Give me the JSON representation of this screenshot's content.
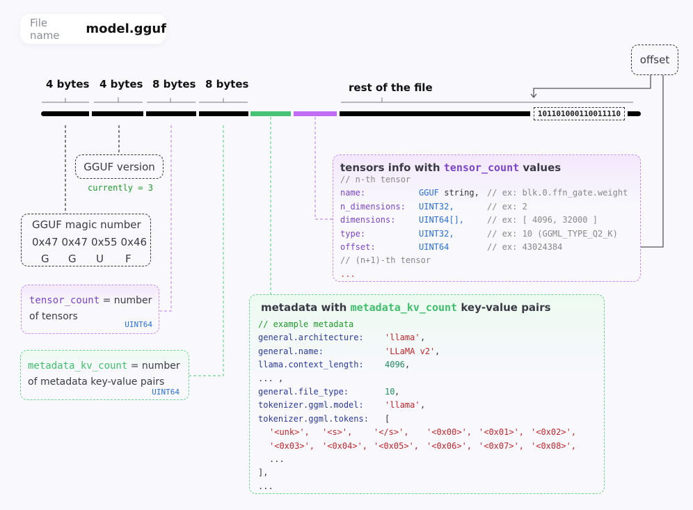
{
  "file": {
    "label": "File name",
    "value": "model.gguf"
  },
  "header_fields": [
    {
      "size": "4 bytes",
      "color": "#000000"
    },
    {
      "size": "4 bytes",
      "color": "#000000"
    },
    {
      "size": "8 bytes",
      "color": "#000000"
    },
    {
      "size": "8 bytes",
      "color": "#000000"
    }
  ],
  "sections": {
    "metadata_color": "#45c275",
    "tensors_info_color": "#c06cf5"
  },
  "rest": {
    "label": "rest of the file",
    "binary": "101101000110011110",
    "offset_label": "offset"
  },
  "version": {
    "title": "GGUF version",
    "note": "currently = 3"
  },
  "magic": {
    "title": "GGUF magic number",
    "hex": [
      "0x47",
      "0x47",
      "0x55",
      "0x46"
    ],
    "chars": [
      "G",
      "G",
      "U",
      "F"
    ]
  },
  "tensor_count": {
    "name": "tensor_count",
    "desc1": "= number",
    "desc2": "of tensors",
    "type": "UINT64"
  },
  "metadata_kv_count": {
    "name": "metadata_kv_count",
    "desc1": "= number",
    "desc2": "of metadata key-value pairs",
    "type": "UINT64"
  },
  "tensors_info": {
    "title_pre": "tensors info with",
    "title_code": "tensor_count",
    "title_post": "values",
    "lines": [
      [
        {
          "t": "// n-th tensor",
          "c": "com",
          "col": 0
        }
      ],
      [
        {
          "t": "name:",
          "c": "key",
          "col": 0
        },
        {
          "t": "GGUF",
          "c": "type",
          "col": 1
        },
        {
          "t": " string,",
          "c": "plain",
          "col": -1
        },
        {
          "t": "// ex: blk.0.ffn_gate.weight",
          "c": "com",
          "col": 2
        }
      ],
      [
        {
          "t": "n_dimensions:",
          "c": "key",
          "col": 0
        },
        {
          "t": "UINT32,",
          "c": "type",
          "col": 1
        },
        {
          "t": "// ex: 2",
          "c": "com",
          "col": 2
        }
      ],
      [
        {
          "t": "dimensions:",
          "c": "key",
          "col": 0
        },
        {
          "t": "UINT64[],",
          "c": "type",
          "col": 1
        },
        {
          "t": "// ex: [ 4096, 32000 ]",
          "c": "com",
          "col": 2
        }
      ],
      [
        {
          "t": "type:",
          "c": "key",
          "col": 0
        },
        {
          "t": "UINT32,",
          "c": "type",
          "col": 1
        },
        {
          "t": "// ex: 10 (GGML_TYPE_Q2_K)",
          "c": "com",
          "col": 2
        }
      ],
      [
        {
          "t": "offset:",
          "c": "key",
          "col": 0
        },
        {
          "t": "UINT64",
          "c": "type",
          "col": 1
        },
        {
          "t": "// ex: 43024384",
          "c": "com",
          "col": 2
        }
      ],
      [
        {
          "t": "// (n+1)-th tensor",
          "c": "com",
          "col": 0
        }
      ],
      [
        {
          "t": "...",
          "c": "red",
          "col": 0
        }
      ]
    ]
  },
  "metadata": {
    "title_pre": "metadata with",
    "title_code": "metadata_kv_count",
    "title_post": "key-value pairs",
    "lines": [
      [
        {
          "t": "// example metadata",
          "c": "gcom",
          "col": 0
        }
      ],
      [
        {
          "t": "general.architecture:",
          "c": "mkey",
          "col": 0
        },
        {
          "t": "'llama'",
          "c": "str",
          "col": 1
        },
        {
          "t": ",",
          "c": "plain",
          "col": -1
        }
      ],
      [
        {
          "t": "general.name:",
          "c": "mkey",
          "col": 0
        },
        {
          "t": "'LLaMA v2'",
          "c": "str",
          "col": 1
        },
        {
          "t": ",",
          "c": "plain",
          "col": -1
        }
      ],
      [
        {
          "t": "llama.context_length:",
          "c": "mkey",
          "col": 0
        },
        {
          "t": "4096",
          "c": "num",
          "col": 1
        },
        {
          "t": ",",
          "c": "plain",
          "col": -1
        }
      ],
      [
        {
          "t": "... ,",
          "c": "plain",
          "col": 0
        }
      ],
      [
        {
          "t": "general.file_type:",
          "c": "mkey",
          "col": 0
        },
        {
          "t": "10",
          "c": "num",
          "col": 1
        },
        {
          "t": ",",
          "c": "plain",
          "col": -1
        }
      ],
      [
        {
          "t": "tokenizer.ggml.model:",
          "c": "mkey",
          "col": 0
        },
        {
          "t": "'llama'",
          "c": "str",
          "col": 1
        },
        {
          "t": ",",
          "c": "plain",
          "col": -1
        }
      ],
      [
        {
          "t": "tokenizer.ggml.tokens:",
          "c": "mkey",
          "col": 0
        },
        {
          "t": "[",
          "c": "plain",
          "col": 1
        }
      ],
      [
        {
          "t": "'<unk>',",
          "c": "str",
          "col": 2
        },
        {
          "t": "'<s>',",
          "c": "str",
          "col": 3
        },
        {
          "t": "'</s>',",
          "c": "str",
          "col": 4
        },
        {
          "t": "'<0x00>',",
          "c": "str",
          "col": 5
        },
        {
          "t": "'<0x01>',",
          "c": "str",
          "col": 6
        },
        {
          "t": "'<0x02>',",
          "c": "str",
          "col": 7
        }
      ],
      [
        {
          "t": "'<0x03>',",
          "c": "str",
          "col": 2
        },
        {
          "t": "'<0x04>',",
          "c": "str",
          "col": 3
        },
        {
          "t": "'<0x05>',",
          "c": "str",
          "col": 4
        },
        {
          "t": "'<0x06>',",
          "c": "str",
          "col": 5
        },
        {
          "t": "'<0x07>',",
          "c": "str",
          "col": 6
        },
        {
          "t": "'<0x08>',",
          "c": "str",
          "col": 7
        }
      ],
      [
        {
          "t": "...",
          "c": "plain",
          "col": 8
        }
      ],
      [
        {
          "t": "],",
          "c": "plain",
          "col": 0
        }
      ],
      [
        {
          "t": "...",
          "c": "plain",
          "col": 0
        }
      ]
    ]
  }
}
